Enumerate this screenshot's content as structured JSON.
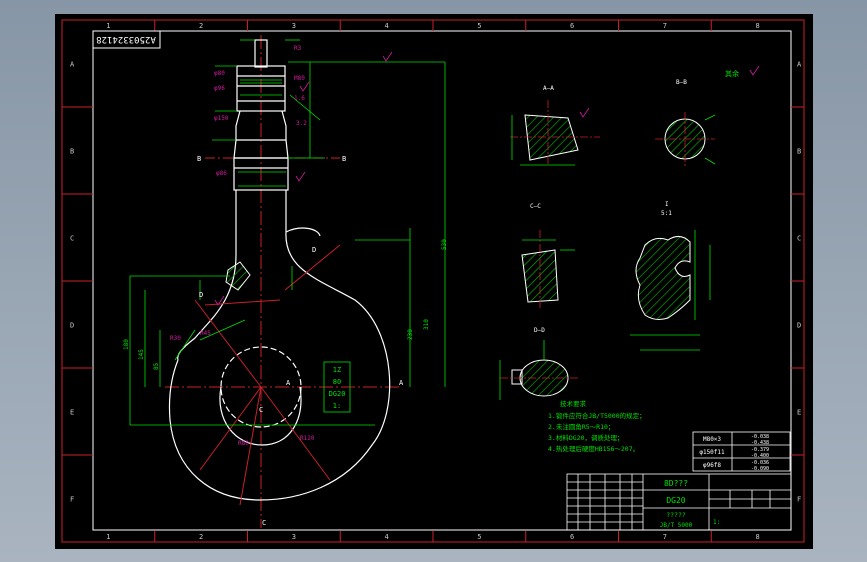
{
  "colors": {
    "background": "#000000",
    "frame": "#c8202a",
    "outline": "#ffffff",
    "dimension": "#00e000",
    "hatch": "#00c000",
    "centerline": "#c8202a",
    "text": "#00e000",
    "annotation": "#d01aa0"
  },
  "border": {
    "columns": [
      "1",
      "2",
      "3",
      "4",
      "5",
      "6",
      "7",
      "8"
    ],
    "rows": [
      "A",
      "B",
      "C",
      "D",
      "E",
      "F"
    ]
  },
  "drawing_number": "A2503324128",
  "sections": {
    "aa": "A—A",
    "bb": "B—B",
    "cc": "C—C",
    "dd": "D—D",
    "detail": "I",
    "detail_scale": "5:1",
    "roughness_note": "其余"
  },
  "cut_markers": {
    "a": "A",
    "b": "B",
    "c": "C",
    "d": "D"
  },
  "center_box": {
    "line1": "1Z",
    "line2": "80",
    "line3": "DG20",
    "line4": "1:"
  },
  "technical_notes": {
    "title": "技术要求",
    "line1": "1.锻件应符合JB/T5000的规定；",
    "line2": "2.未注圆角R5～R10；",
    "line3": "3.材料DG20，调质处理；",
    "line4": "4.热处理后硬度HB156～207。"
  },
  "tolerance_table": [
    {
      "label": "M80×3",
      "value1": "-0.038",
      "value2": "-0.438"
    },
    {
      "label": "φ150f11",
      "value1": "-0.379",
      "value2": "-0.400"
    },
    {
      "label": "φ96f8",
      "value1": "-0.036",
      "value2": "-0.090"
    }
  ],
  "title_block": {
    "name": "8D???",
    "material": "DG20",
    "company": "?????",
    "standard": "JB/T 5000",
    "scale": "1:"
  }
}
